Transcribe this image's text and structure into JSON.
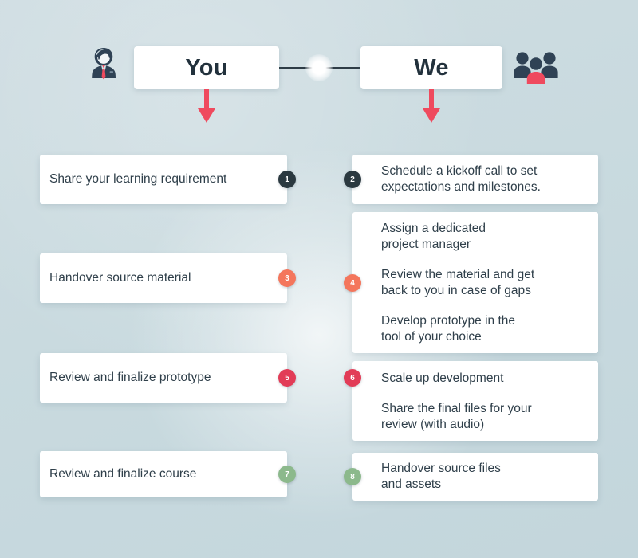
{
  "header": {
    "left": {
      "title": "You",
      "icon": "businessman-icon"
    },
    "right": {
      "title": "We",
      "icon": "team-group-icon"
    }
  },
  "colors": {
    "background": "#ccdce1",
    "card": "#ffffff",
    "text": "#2f3f4a",
    "title": "#22313c",
    "arrow": "#ef4a5e",
    "badge_navy": "#2b3940",
    "badge_coral": "#f4765c",
    "badge_red": "#e23c57",
    "badge_green": "#8cb98c",
    "connector": "#2e3c46"
  },
  "rows": [
    {
      "left": {
        "badge": "1",
        "badge_color": "#2b3940",
        "lines": [
          "Share your learning requirement"
        ]
      },
      "right": {
        "badge": "2",
        "badge_color": "#2b3940",
        "paragraphs": [
          [
            "Schedule a kickoff call to set",
            "expectations and milestones."
          ]
        ]
      }
    },
    {
      "left": {
        "badge": "3",
        "badge_color": "#f4765c",
        "lines": [
          "Handover source material"
        ]
      },
      "right": {
        "badge": "4",
        "badge_color": "#f4765c",
        "paragraphs": [
          [
            "Assign a dedicated",
            "project manager"
          ],
          [
            "Review the material and get",
            "back to you in case of gaps"
          ],
          [
            "Develop prototype in the",
            "tool of your choice"
          ]
        ]
      }
    },
    {
      "left": {
        "badge": "5",
        "badge_color": "#e23c57",
        "lines": [
          "Review and finalize prototype"
        ]
      },
      "right": {
        "badge": "6",
        "badge_color": "#e23c57",
        "paragraphs": [
          [
            "Scale up development"
          ],
          [
            "Share the final files for your",
            "review (with audio)"
          ]
        ]
      }
    },
    {
      "left": {
        "badge": "7",
        "badge_color": "#8cb98c",
        "lines": [
          "Review and finalize course"
        ]
      },
      "right": {
        "badge": "8",
        "badge_color": "#8cb98c",
        "paragraphs": [
          [
            "Handover source files",
            "and assets"
          ]
        ]
      }
    }
  ]
}
